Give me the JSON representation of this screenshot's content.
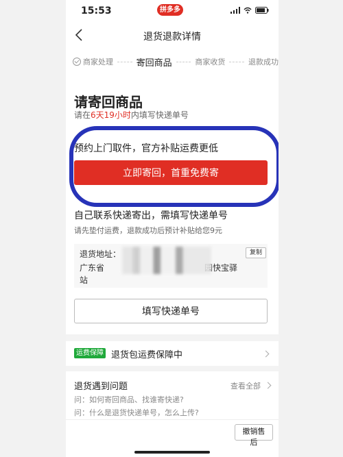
{
  "status_bar": {
    "time": "15:53",
    "app_badge": "拼多多"
  },
  "nav": {
    "title": "退货退款详情"
  },
  "progress": {
    "steps": [
      "商家处理",
      "寄回商品",
      "商家收货",
      "退款成功"
    ],
    "active_step": "寄回商品"
  },
  "section": {
    "title": "请寄回商品",
    "hint_prefix": "请在",
    "hint_time": "6天19小时",
    "hint_suffix": "内填写快递单号"
  },
  "pickup": {
    "text": "预约上门取件，官方补贴运费更低",
    "button_label": "立即寄回，首重免费寄"
  },
  "self_send": {
    "title": "自己联系快递寄出，需填写快递单号",
    "hint": "请先垫付运费，退款成功后预计补贴给您9元"
  },
  "address": {
    "label": "退货地址：",
    "line_start": "广东省",
    "line_end": "园快宝驿",
    "line2": "站",
    "copy_label": "复制"
  },
  "fill_button": "填写快递单号",
  "guarantee": {
    "badge": "运费保障",
    "text": "退货包运费保障中"
  },
  "faq": {
    "title": "退货遇到问题",
    "view_all": "查看全部",
    "q1": "问：如何寄回商品、找谁寄快递?",
    "q2": "问：什么是退货快递单号，怎么上传?"
  },
  "bottom": {
    "cancel_label": "撤销售后"
  },
  "colors": {
    "accent": "#e02e24",
    "annotation": "#2733b8",
    "guarantee": "#1fa93a"
  }
}
